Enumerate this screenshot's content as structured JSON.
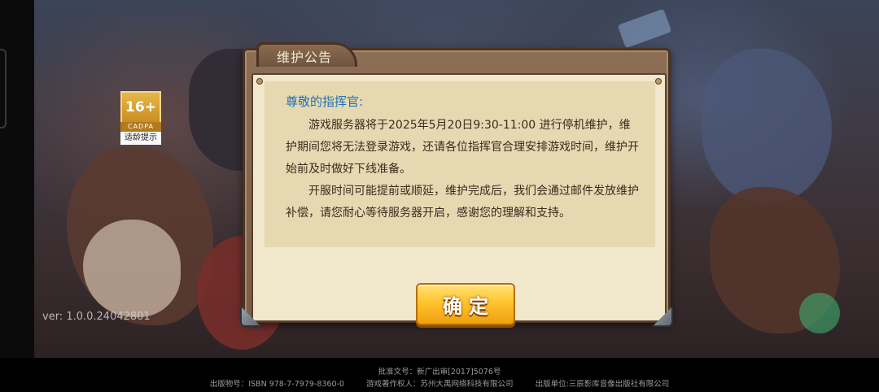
{
  "version": "ver: 1.0.0.24042801",
  "age_rating": {
    "age": "16+",
    "org": "CADPA",
    "label": "适龄提示"
  },
  "dialog": {
    "title": "维护公告",
    "greeting": "尊敬的指挥官:",
    "paragraphs": [
      "游戏服务器将于2025年5月20日9:30-11:00  进行停机维护，维护期间您将无法登录游戏，还请各位指挥官合理安排游戏时间，维护开始前及时做好下线准备。",
      "开服时间可能提前或顺延，维护完成后，我们会通过邮件发放维护补偿，请您耐心等待服务器开启，感谢您的理解和支持。"
    ],
    "confirm_label": "确定"
  },
  "footer": {
    "approval": "批准文号：新广出审[2017]5076号",
    "isbn": "出版物号：ISBN 978-7-7979-8360-0",
    "copyright": "游戏著作权人：苏州大禹网络科技有限公司",
    "publisher": "出版单位:三辰影库音像出版社有限公司"
  },
  "colors": {
    "accent_blue": "#1f6fb8",
    "button_gold": "#ffc42e",
    "parchment": "#f1e7ca",
    "frame_brown": "#7a5e48"
  }
}
